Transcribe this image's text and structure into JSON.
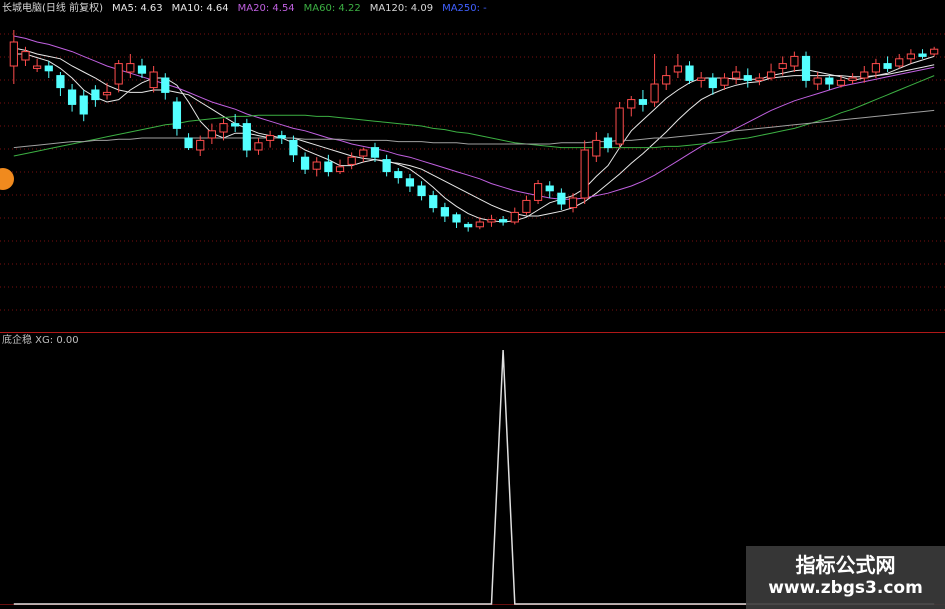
{
  "header": {
    "stock": "长城电脑(日线 前复权)",
    "ma5": "MA5: 4.63",
    "ma10": "MA10: 4.64",
    "ma20": "MA20: 4.54",
    "ma60": "MA60: 4.22",
    "ma120": "MA120: 4.09",
    "ma250": "MA250: -"
  },
  "indicator": {
    "label": "底企稳 XG: 0.00"
  },
  "watermark": {
    "line1": "指标公式网",
    "line2": "www.zbgs3.com"
  },
  "colors": {
    "up": "#ff4d4d",
    "down": "#54ffff",
    "ma5": "#e8e8e8",
    "ma10": "#e8e8e8",
    "ma20": "#c060e0",
    "ma60": "#3cb043",
    "ma120": "#a0a0a0",
    "grid": "#7a1010",
    "signal": "#e0e0e0"
  },
  "chart_data": [
    {
      "type": "candlestick",
      "title": "长城电脑(日线 前复权)",
      "ylim": [
        3.0,
        5.6
      ],
      "candles": [
        [
          5.2,
          5.4,
          5.05,
          5.5
        ],
        [
          5.25,
          5.32,
          5.2,
          5.36
        ],
        [
          5.18,
          5.2,
          5.15,
          5.26
        ],
        [
          5.2,
          5.16,
          5.1,
          5.24
        ],
        [
          5.12,
          5.02,
          4.95,
          5.15
        ],
        [
          5.0,
          4.88,
          4.82,
          5.05
        ],
        [
          4.95,
          4.8,
          4.74,
          5.0
        ],
        [
          5.0,
          4.92,
          4.86,
          5.04
        ],
        [
          4.96,
          4.98,
          4.92,
          5.06
        ],
        [
          5.05,
          5.22,
          4.98,
          5.25
        ],
        [
          5.15,
          5.22,
          5.1,
          5.3
        ],
        [
          5.2,
          5.14,
          5.1,
          5.26
        ],
        [
          5.02,
          5.15,
          4.98,
          5.2
        ],
        [
          5.1,
          4.98,
          4.92,
          5.14
        ],
        [
          4.9,
          4.68,
          4.62,
          4.94
        ],
        [
          4.6,
          4.52,
          4.5,
          4.64
        ],
        [
          4.5,
          4.58,
          4.45,
          4.62
        ],
        [
          4.6,
          4.66,
          4.55,
          4.72
        ],
        [
          4.65,
          4.72,
          4.58,
          4.76
        ],
        [
          4.72,
          4.7,
          4.65,
          4.8
        ],
        [
          4.72,
          4.5,
          4.44,
          4.76
        ],
        [
          4.5,
          4.56,
          4.46,
          4.6
        ],
        [
          4.58,
          4.62,
          4.52,
          4.66
        ],
        [
          4.62,
          4.6,
          4.55,
          4.66
        ],
        [
          4.58,
          4.46,
          4.4,
          4.62
        ],
        [
          4.44,
          4.34,
          4.3,
          4.48
        ],
        [
          4.34,
          4.4,
          4.28,
          4.44
        ],
        [
          4.4,
          4.32,
          4.28,
          4.46
        ],
        [
          4.32,
          4.36,
          4.3,
          4.42
        ],
        [
          4.38,
          4.44,
          4.34,
          4.48
        ],
        [
          4.45,
          4.5,
          4.4,
          4.52
        ],
        [
          4.52,
          4.44,
          4.4,
          4.56
        ],
        [
          4.42,
          4.32,
          4.28,
          4.46
        ],
        [
          4.32,
          4.27,
          4.22,
          4.35
        ],
        [
          4.26,
          4.2,
          4.15,
          4.3
        ],
        [
          4.2,
          4.12,
          4.08,
          4.24
        ],
        [
          4.12,
          4.02,
          3.98,
          4.16
        ],
        [
          4.02,
          3.95,
          3.9,
          4.06
        ],
        [
          3.96,
          3.9,
          3.85,
          3.98
        ],
        [
          3.88,
          3.86,
          3.82,
          3.9
        ],
        [
          3.86,
          3.9,
          3.84,
          3.94
        ],
        [
          3.9,
          3.92,
          3.86,
          3.96
        ],
        [
          3.92,
          3.9,
          3.87,
          3.95
        ],
        [
          3.9,
          3.98,
          3.88,
          4.02
        ],
        [
          3.98,
          4.08,
          3.96,
          4.12
        ],
        [
          4.08,
          4.22,
          4.05,
          4.25
        ],
        [
          4.2,
          4.16,
          4.1,
          4.24
        ],
        [
          4.14,
          4.05,
          4.0,
          4.18
        ],
        [
          4.02,
          4.1,
          3.98,
          4.14
        ],
        [
          4.1,
          4.5,
          4.05,
          4.58
        ],
        [
          4.45,
          4.58,
          4.4,
          4.65
        ],
        [
          4.6,
          4.52,
          4.48,
          4.64
        ],
        [
          4.55,
          4.85,
          4.52,
          4.9
        ],
        [
          4.85,
          4.92,
          4.78,
          4.95
        ],
        [
          4.92,
          4.88,
          4.82,
          5.0
        ],
        [
          4.9,
          5.05,
          4.86,
          5.3
        ],
        [
          5.05,
          5.12,
          5.0,
          5.2
        ],
        [
          5.15,
          5.2,
          5.1,
          5.3
        ],
        [
          5.2,
          5.08,
          5.05,
          5.24
        ],
        [
          5.08,
          5.1,
          5.02,
          5.15
        ],
        [
          5.1,
          5.02,
          4.96,
          5.14
        ],
        [
          5.04,
          5.1,
          5.0,
          5.14
        ],
        [
          5.1,
          5.15,
          5.05,
          5.2
        ],
        [
          5.12,
          5.08,
          5.02,
          5.18
        ],
        [
          5.08,
          5.1,
          5.04,
          5.14
        ],
        [
          5.1,
          5.15,
          5.08,
          5.22
        ],
        [
          5.18,
          5.22,
          5.12,
          5.28
        ],
        [
          5.2,
          5.28,
          5.15,
          5.32
        ],
        [
          5.28,
          5.08,
          5.02,
          5.32
        ],
        [
          5.05,
          5.1,
          5.0,
          5.15
        ],
        [
          5.1,
          5.05,
          5.0,
          5.12
        ],
        [
          5.04,
          5.08,
          5.02,
          5.12
        ],
        [
          5.08,
          5.1,
          5.05,
          5.14
        ],
        [
          5.1,
          5.15,
          5.06,
          5.2
        ],
        [
          5.15,
          5.22,
          5.1,
          5.26
        ],
        [
          5.22,
          5.18,
          5.15,
          5.28
        ],
        [
          5.2,
          5.26,
          5.18,
          5.3
        ],
        [
          5.26,
          5.3,
          5.22,
          5.34
        ],
        [
          5.3,
          5.28,
          5.26,
          5.34
        ],
        [
          5.3,
          5.34,
          5.28,
          5.36
        ]
      ],
      "series": [
        {
          "name": "MA5",
          "values": [
            5.3,
            5.3,
            5.27,
            5.24,
            5.18,
            5.1,
            5.0,
            4.94,
            4.9,
            4.92,
            5.0,
            5.06,
            5.1,
            5.1,
            5.04,
            4.9,
            4.74,
            4.64,
            4.6,
            4.64,
            4.64,
            4.62,
            4.6,
            4.6,
            4.56,
            4.5,
            4.46,
            4.42,
            4.37,
            4.37,
            4.4,
            4.42,
            4.41,
            4.38,
            4.34,
            4.27,
            4.19,
            4.1,
            4.03,
            3.97,
            3.93,
            3.91,
            3.9,
            3.91,
            3.94,
            4.0,
            4.06,
            4.09,
            4.12,
            4.18,
            4.28,
            4.37,
            4.52,
            4.66,
            4.75,
            4.84,
            4.93,
            5.0,
            5.06,
            5.1,
            5.1,
            5.1,
            5.09,
            5.09,
            5.09,
            5.12,
            5.14,
            5.16,
            5.17,
            5.15,
            5.13,
            5.11,
            5.08,
            5.1,
            5.12,
            5.14,
            5.18,
            5.22,
            5.25,
            5.28
          ]
        },
        {
          "name": "MA10",
          "values": [
            5.35,
            5.33,
            5.3,
            5.28,
            5.26,
            5.2,
            5.15,
            5.1,
            5.04,
            5.0,
            4.98,
            4.98,
            5.0,
            5.0,
            4.98,
            4.96,
            4.9,
            4.84,
            4.78,
            4.72,
            4.68,
            4.64,
            4.62,
            4.6,
            4.6,
            4.57,
            4.54,
            4.51,
            4.48,
            4.45,
            4.43,
            4.42,
            4.4,
            4.39,
            4.37,
            4.34,
            4.29,
            4.24,
            4.19,
            4.14,
            4.09,
            4.04,
            4.0,
            3.97,
            3.95,
            3.95,
            3.97,
            3.99,
            4.02,
            4.07,
            4.14,
            4.22,
            4.3,
            4.39,
            4.47,
            4.56,
            4.65,
            4.75,
            4.84,
            4.92,
            4.97,
            5.01,
            5.04,
            5.06,
            5.07,
            5.1,
            5.11,
            5.12,
            5.12,
            5.12,
            5.12,
            5.12,
            5.11,
            5.11,
            5.12,
            5.13,
            5.15,
            5.17,
            5.19,
            5.21
          ]
        },
        {
          "name": "MA20",
          "values": [
            5.45,
            5.43,
            5.4,
            5.38,
            5.35,
            5.32,
            5.28,
            5.24,
            5.2,
            5.17,
            5.14,
            5.11,
            5.08,
            5.05,
            5.02,
            4.98,
            4.94,
            4.9,
            4.87,
            4.84,
            4.8,
            4.77,
            4.74,
            4.71,
            4.68,
            4.66,
            4.63,
            4.6,
            4.58,
            4.55,
            4.53,
            4.51,
            4.49,
            4.46,
            4.44,
            4.41,
            4.38,
            4.35,
            4.32,
            4.29,
            4.26,
            4.22,
            4.19,
            4.16,
            4.14,
            4.12,
            4.1,
            4.09,
            4.09,
            4.1,
            4.12,
            4.14,
            4.17,
            4.2,
            4.24,
            4.29,
            4.35,
            4.41,
            4.47,
            4.53,
            4.58,
            4.63,
            4.68,
            4.73,
            4.78,
            4.83,
            4.87,
            4.91,
            4.94,
            4.97,
            5.0,
            5.03,
            5.05,
            5.07,
            5.09,
            5.11,
            5.13,
            5.15,
            5.17,
            5.19
          ]
        },
        {
          "name": "MA60",
          "values": [
            4.45,
            4.47,
            4.49,
            4.51,
            4.53,
            4.55,
            4.57,
            4.59,
            4.61,
            4.63,
            4.65,
            4.67,
            4.69,
            4.71,
            4.72,
            4.74,
            4.75,
            4.76,
            4.77,
            4.78,
            4.78,
            4.79,
            4.79,
            4.79,
            4.79,
            4.79,
            4.78,
            4.78,
            4.77,
            4.76,
            4.75,
            4.74,
            4.73,
            4.72,
            4.71,
            4.7,
            4.68,
            4.67,
            4.65,
            4.64,
            4.62,
            4.6,
            4.58,
            4.56,
            4.55,
            4.54,
            4.53,
            4.52,
            4.52,
            4.52,
            4.52,
            4.52,
            4.52,
            4.52,
            4.52,
            4.52,
            4.53,
            4.53,
            4.54,
            4.55,
            4.56,
            4.57,
            4.59,
            4.6,
            4.62,
            4.64,
            4.66,
            4.68,
            4.71,
            4.74,
            4.77,
            4.81,
            4.84,
            4.88,
            4.92,
            4.96,
            5.0,
            5.04,
            5.08,
            5.12
          ]
        },
        {
          "name": "MA120",
          "values": [
            4.52,
            4.53,
            4.54,
            4.55,
            4.56,
            4.57,
            4.57,
            4.58,
            4.58,
            4.59,
            4.59,
            4.6,
            4.6,
            4.6,
            4.6,
            4.6,
            4.6,
            4.6,
            4.6,
            4.6,
            4.6,
            4.6,
            4.6,
            4.6,
            4.6,
            4.59,
            4.59,
            4.59,
            4.59,
            4.58,
            4.58,
            4.58,
            4.58,
            4.57,
            4.57,
            4.57,
            4.56,
            4.56,
            4.56,
            4.55,
            4.55,
            4.55,
            4.55,
            4.55,
            4.55,
            4.55,
            4.55,
            4.56,
            4.56,
            4.56,
            4.57,
            4.57,
            4.58,
            4.58,
            4.59,
            4.6,
            4.6,
            4.61,
            4.62,
            4.63,
            4.64,
            4.65,
            4.66,
            4.67,
            4.68,
            4.69,
            4.7,
            4.71,
            4.72,
            4.73,
            4.74,
            4.75,
            4.76,
            4.77,
            4.78,
            4.79,
            4.8,
            4.81,
            4.82,
            4.83
          ]
        }
      ]
    },
    {
      "type": "line",
      "title": "底企稳 XG: 0.00",
      "ylim": [
        0,
        1
      ],
      "values": [
        0,
        0,
        0,
        0,
        0,
        0,
        0,
        0,
        0,
        0,
        0,
        0,
        0,
        0,
        0,
        0,
        0,
        0,
        0,
        0,
        0,
        0,
        0,
        0,
        0,
        0,
        0,
        0,
        0,
        0,
        0,
        0,
        0,
        0,
        0,
        0,
        0,
        0,
        0,
        0,
        0,
        0,
        1,
        0,
        0,
        0,
        0,
        0,
        0,
        0,
        0,
        0,
        0,
        0,
        0,
        0,
        0,
        0,
        0,
        0,
        0,
        0,
        0,
        0,
        0,
        0,
        0,
        0,
        0,
        0,
        0,
        0,
        0,
        0,
        0,
        0,
        0,
        0,
        0,
        0
      ]
    }
  ]
}
